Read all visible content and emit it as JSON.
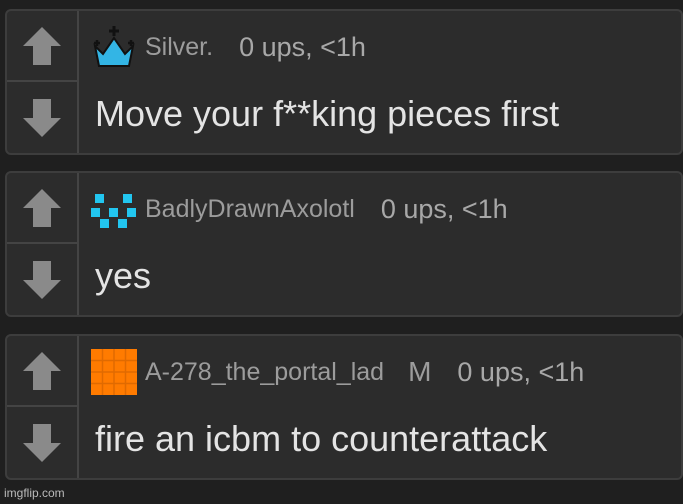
{
  "colors": {
    "background": "#1f1f1f",
    "card": "#2c2c2c",
    "card_border": "#3d3d3d",
    "arrow": "#8a8a8a",
    "crown": "#33b5e5",
    "axolotl_icon": "#22c6f0",
    "square_avatar": "#ff7b00"
  },
  "comments": [
    {
      "avatar_icon": "crown-icon",
      "username": "Silver.",
      "mod_badge": "",
      "ups": "0 ups, <1h",
      "text": "Move your f**king pieces first"
    },
    {
      "avatar_icon": "pixel-face-icon",
      "username": "BadlyDrawnAxolotl",
      "mod_badge": "",
      "ups": "0 ups, <1h",
      "text": "yes"
    },
    {
      "avatar_icon": "orange-grid-avatar",
      "username": "A-278_the_portal_lad",
      "mod_badge": "M",
      "ups": "0 ups, <1h",
      "text": "fire an icbm to counterattack"
    }
  ],
  "footer": "imgflip.com"
}
